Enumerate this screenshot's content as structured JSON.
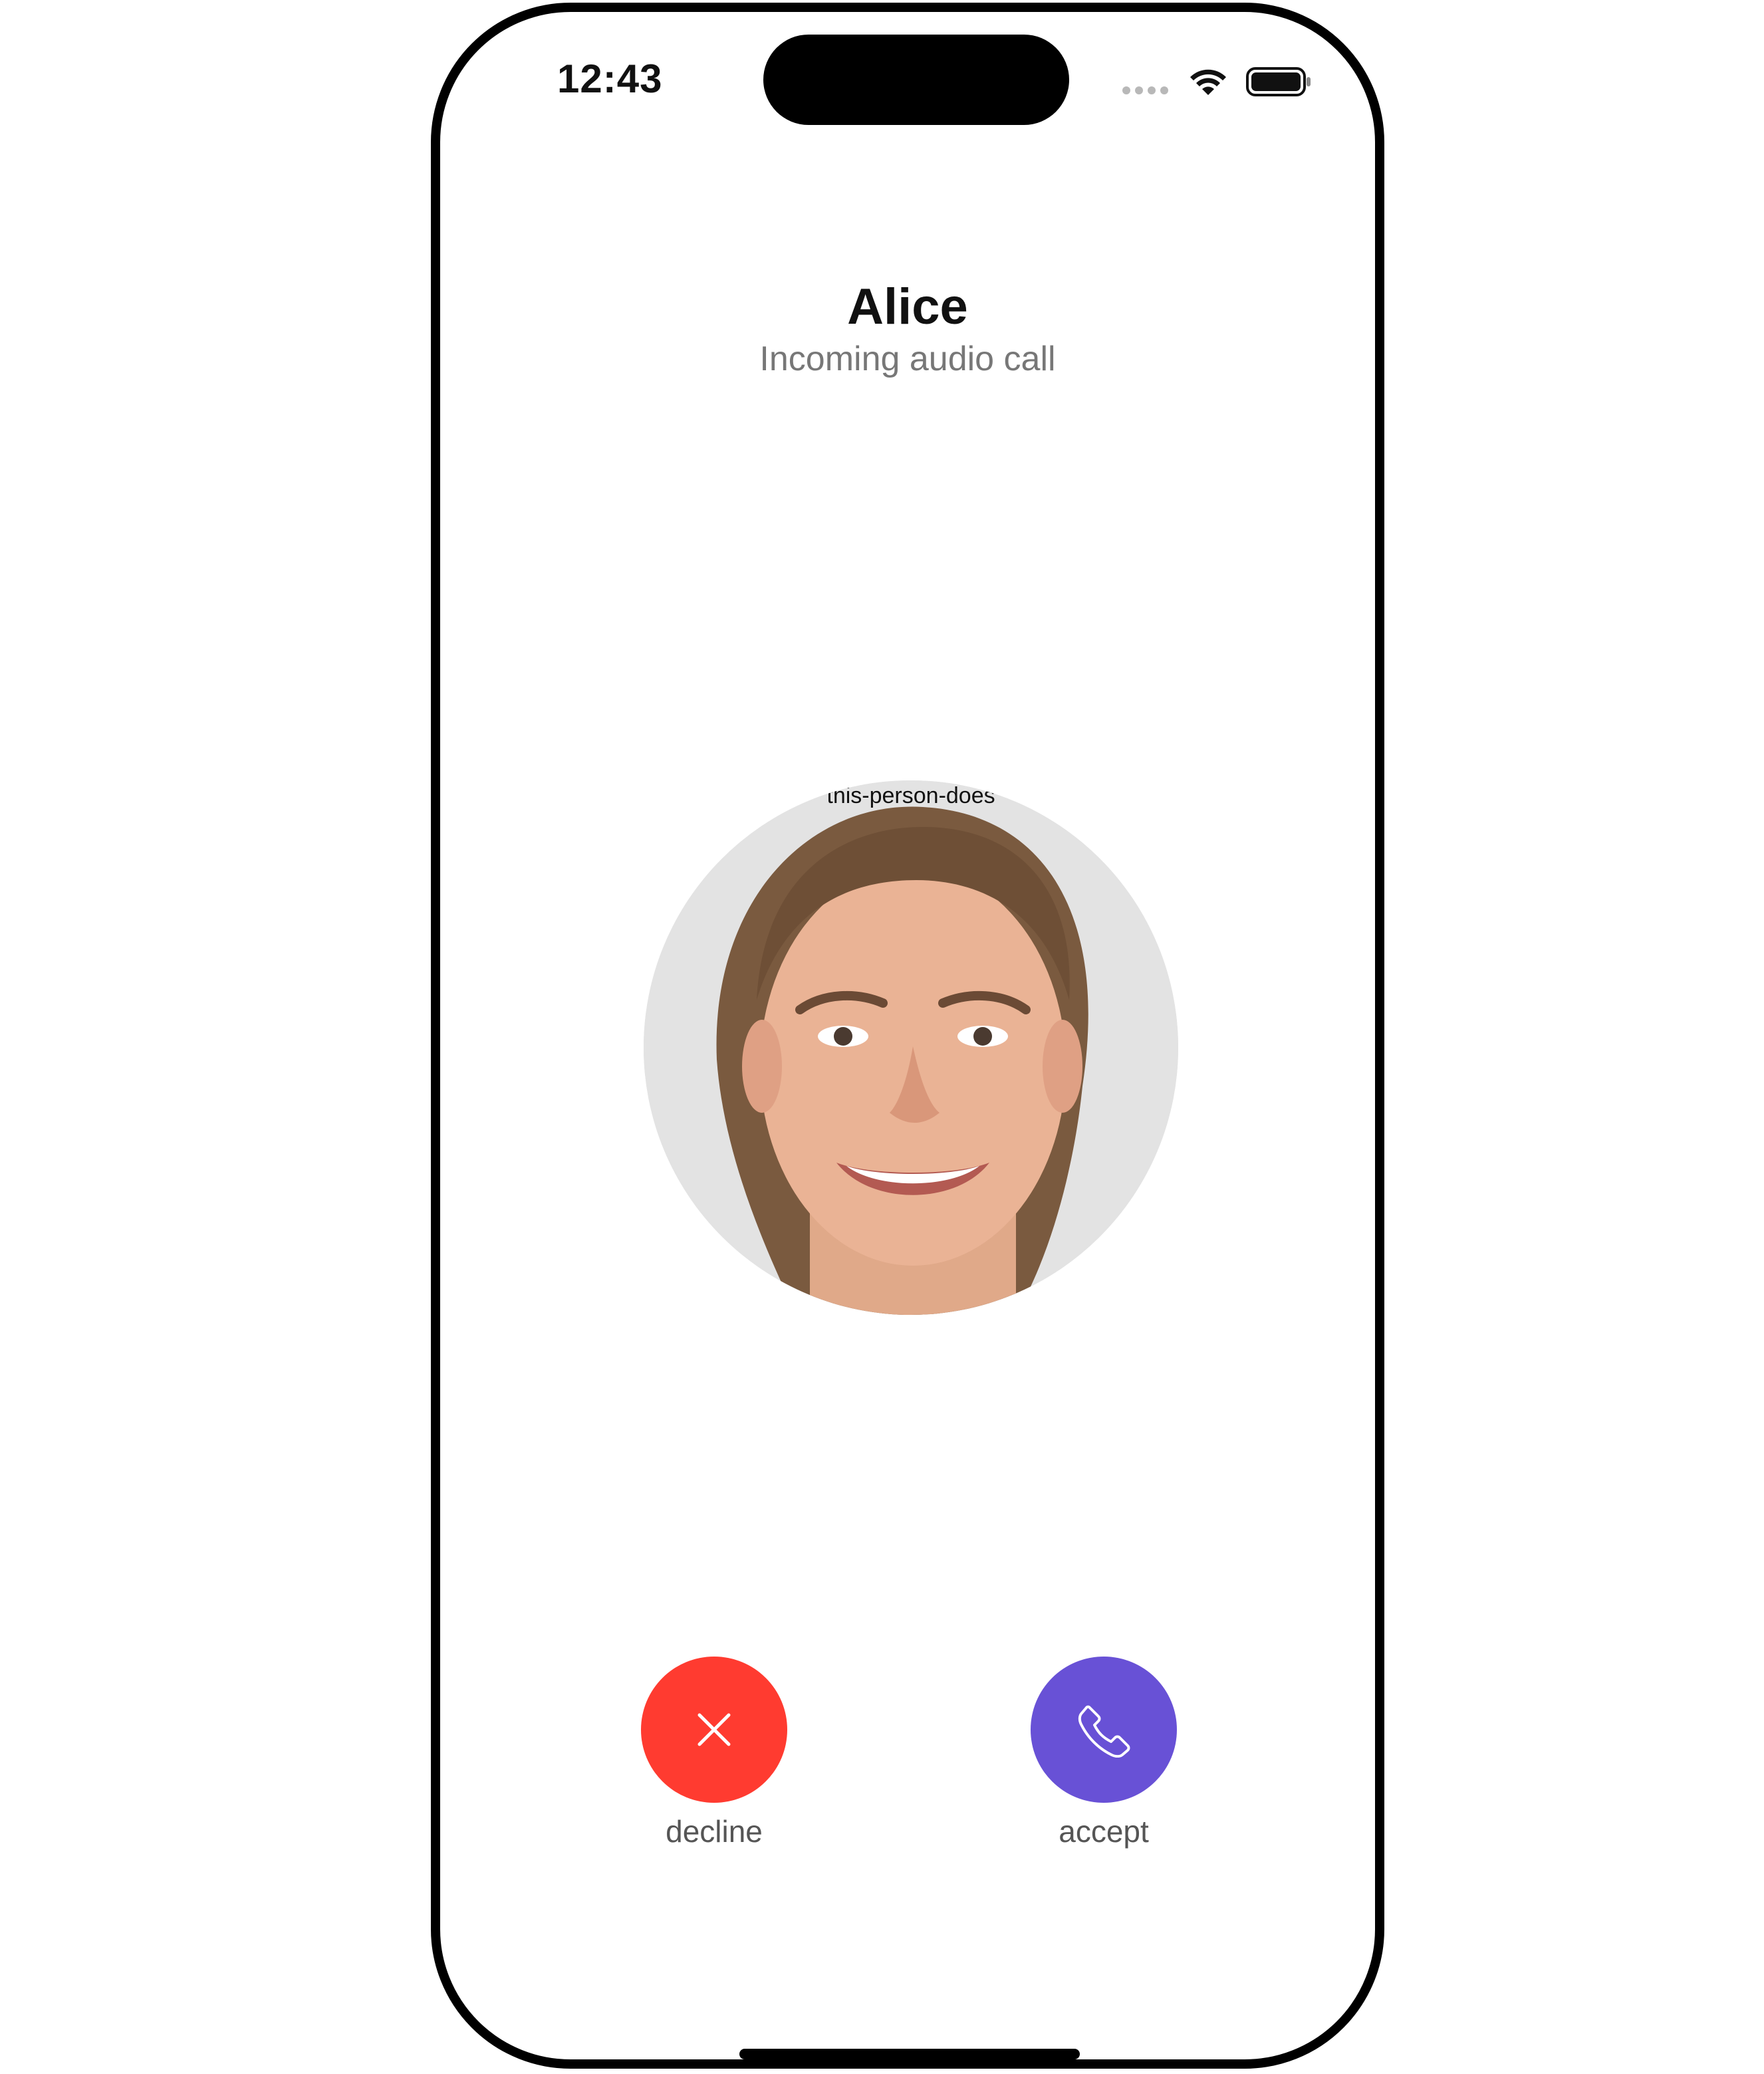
{
  "status_bar": {
    "time": "12:43",
    "wifi_icon": "wifi-icon",
    "battery_icon": "battery-icon",
    "signal_icon": "cellular-dots-icon"
  },
  "call": {
    "caller_name": "Alice",
    "status": "Incoming audio call",
    "avatar_caption": "this-person-does"
  },
  "actions": {
    "decline": {
      "label": "decline",
      "icon": "close-icon",
      "color": "#FF3B30"
    },
    "accept": {
      "label": "accept",
      "icon": "phone-icon",
      "color": "#6851D6"
    }
  }
}
